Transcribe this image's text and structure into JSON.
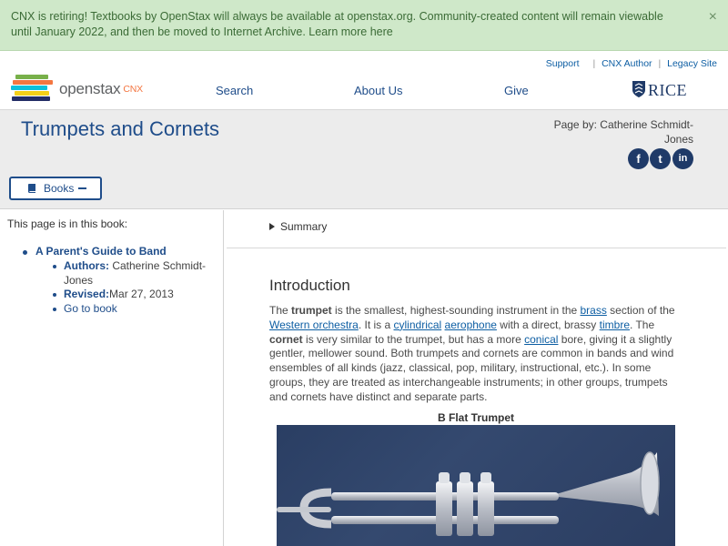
{
  "banner": {
    "text": "CNX is retiring! Textbooks by OpenStax will always be available at openstax.org. Community-created content will remain viewable until January 2022, and then be moved to Internet Archive. Learn more ",
    "link": "here",
    "close": "×"
  },
  "header": {
    "util_links": [
      "Support",
      "CNX Author",
      "Legacy Site"
    ],
    "logo_text": "openstax",
    "logo_sub": "CNX",
    "nav": [
      "Search",
      "About Us",
      "Give"
    ],
    "rice": "RICE"
  },
  "page": {
    "title": "Trumpets and Cornets",
    "page_by": "Page by: Catherine Schmidt-Jones",
    "social": [
      "f",
      "t",
      "in"
    ],
    "books_button": "Books"
  },
  "sidebar": {
    "heading": "This page is in this book:",
    "book_title": "A Parent's Guide to Band",
    "authors_label": "Authors:",
    "authors_value": " Catherine Schmidt-Jones",
    "revised_label": "Revised:",
    "revised_value": "Mar 27, 2013",
    "go_link": "Go to book"
  },
  "main": {
    "summary": "Summary",
    "heading": "Introduction",
    "para": {
      "p1": "The ",
      "trumpet": "trumpet",
      "p2": " is the smallest, highest-sounding instrument in the ",
      "brass": "brass",
      "p3": " section of the ",
      "western": "Western orchestra",
      "p4": ". It is a ",
      "cylindrical": "cylindrical",
      "p5": " ",
      "aerophone": "aerophone",
      "p6": " with a direct, brassy ",
      "timbre": "timbre",
      "p7": ". The ",
      "cornet": "cornet",
      "p8": " is very similar to the trumpet, but has a more ",
      "conical": "conical",
      "p9": " bore, giving it a slightly gentler, mellower sound. Both trumpets and cornets are common in bands and wind ensembles of all kinds (jazz, classical, pop, military, instructional, etc.). In some groups, they are treated as interchangeable instruments; in other groups, trumpets and cornets have distinct and separate parts."
    },
    "figure_caption": "B Flat Trumpet"
  }
}
